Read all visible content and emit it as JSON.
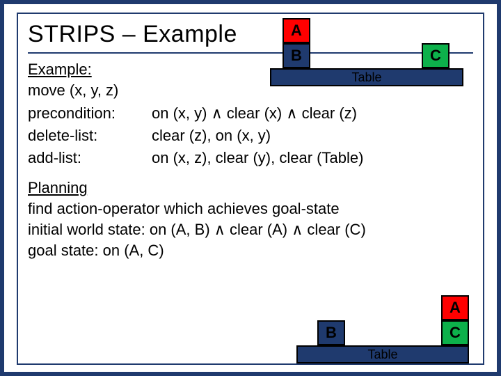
{
  "title": "STRIPS – Example",
  "example": {
    "heading": "Example:",
    "move": "move (x, y, z)",
    "labels": {
      "precondition": "precondition:",
      "delete": "delete-list:",
      "add": "add-list:"
    },
    "values": {
      "precondition": "on (x, y) ∧ clear (x) ∧ clear (z)",
      "delete": "clear (z), on (x, y)",
      "add": "on (x, z), clear (y), clear (Table)"
    }
  },
  "planning": {
    "heading": "Planning",
    "line1": "find action-operator which achieves goal-state",
    "line2": "initial world state: on (A, B) ∧ clear (A) ∧ clear (C)",
    "line3": "goal state: on (A, C)"
  },
  "blocks": {
    "A": "A",
    "B": "B",
    "C": "C"
  },
  "table_label": "Table"
}
